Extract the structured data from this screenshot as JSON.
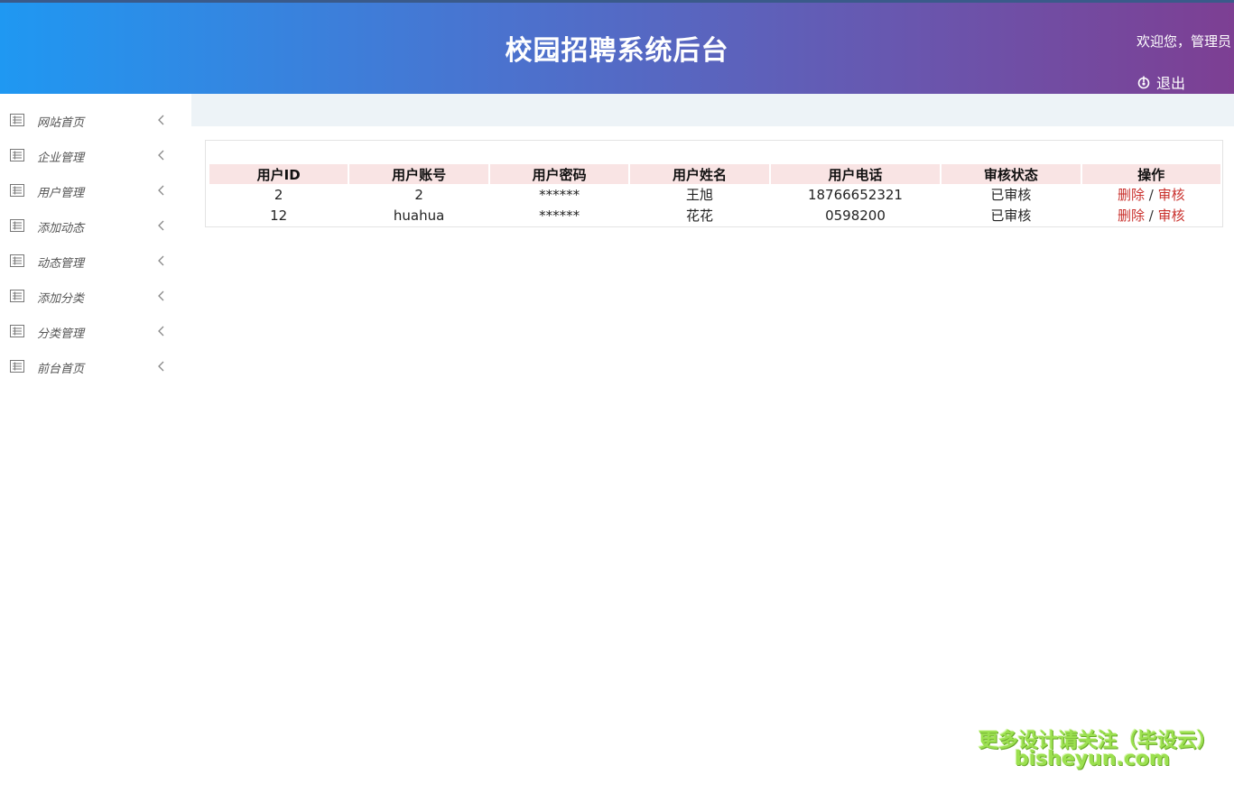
{
  "header": {
    "title": "校园招聘系统后台",
    "welcome": "欢迎您，管理员",
    "logout_label": "退出"
  },
  "sidebar": {
    "items": [
      {
        "label": "网站首页",
        "icon": "list-icon"
      },
      {
        "label": "企业管理",
        "icon": "list-icon"
      },
      {
        "label": "用户管理",
        "icon": "list-icon"
      },
      {
        "label": "添加动态",
        "icon": "list-icon"
      },
      {
        "label": "动态管理",
        "icon": "list-icon"
      },
      {
        "label": "添加分类",
        "icon": "list-icon"
      },
      {
        "label": "分类管理",
        "icon": "list-icon"
      },
      {
        "label": "前台首页",
        "icon": "list-icon"
      }
    ]
  },
  "table": {
    "headers": [
      "用户ID",
      "用户账号",
      "用户密码",
      "用户姓名",
      "用户电话",
      "审核状态",
      "操作"
    ],
    "rows": [
      {
        "id": "2",
        "account": "2",
        "password": "******",
        "name": "王旭",
        "phone": "18766652321",
        "status": "已审核",
        "delete_label": "删除",
        "sep": "/",
        "audit_label": "审核"
      },
      {
        "id": "12",
        "account": "huahua",
        "password": "******",
        "name": "花花",
        "phone": "0598200",
        "status": "已审核",
        "delete_label": "删除",
        "sep": "/",
        "audit_label": "审核"
      }
    ]
  },
  "watermark": {
    "line1": "更多设计请关注（毕设云）",
    "line2": "bisheyun.com"
  },
  "colors": {
    "header_start": "#1f98f2",
    "header_end": "#7d3f93",
    "table_header_bg": "#f9e4e4",
    "link_red": "#c9302c",
    "watermark_green": "#9be04f"
  }
}
